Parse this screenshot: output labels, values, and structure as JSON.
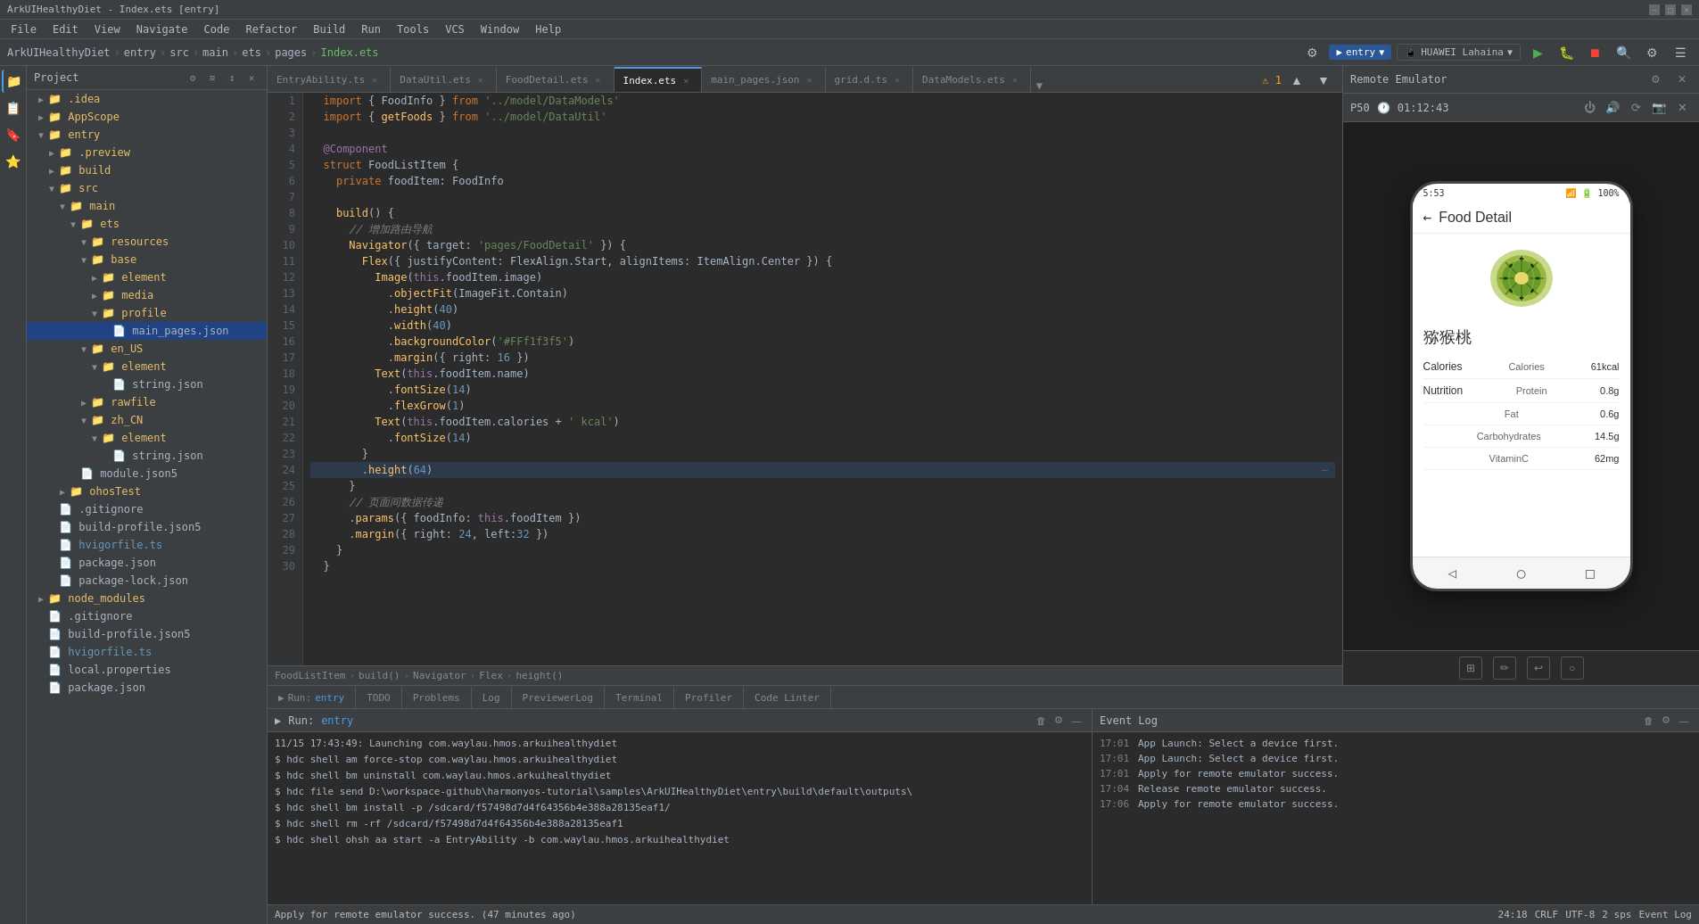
{
  "window": {
    "title": "ArkUIHealthyDiet - Index.ets [entry]",
    "controls": [
      "—",
      "□",
      "✕"
    ]
  },
  "menubar": {
    "items": [
      "File",
      "Edit",
      "View",
      "Navigate",
      "Code",
      "Refactor",
      "Build",
      "Run",
      "Tools",
      "VCS",
      "Window",
      "Help"
    ]
  },
  "project_header": {
    "breadcrumbs": [
      "ArkUIHealthyDiet",
      "entry",
      "src",
      "main",
      "ets",
      "pages",
      "Index.ets"
    ]
  },
  "toolbar": {
    "left_buttons": [
      "⚙",
      "≡",
      "⊞",
      "☷",
      "⚙"
    ],
    "right_buttons": [
      "▶",
      "⏸",
      "⏹",
      "🔨",
      "🔍",
      "⚙",
      "☰"
    ]
  },
  "sidebar": {
    "title": "Project",
    "icons": [
      "⚙",
      "≡",
      "↕",
      "⚙"
    ],
    "tree": [
      {
        "label": ".idea",
        "type": "folder",
        "indent": 1,
        "collapsed": true
      },
      {
        "label": "AppScope",
        "type": "folder",
        "indent": 1,
        "collapsed": true
      },
      {
        "label": "entry",
        "type": "folder",
        "indent": 1,
        "collapsed": false
      },
      {
        "label": ".preview",
        "type": "folder",
        "indent": 2,
        "collapsed": true
      },
      {
        "label": "build",
        "type": "folder",
        "indent": 2,
        "collapsed": true
      },
      {
        "label": "src",
        "type": "folder",
        "indent": 2,
        "collapsed": false
      },
      {
        "label": "main",
        "type": "folder",
        "indent": 3,
        "collapsed": false
      },
      {
        "label": "ets",
        "type": "folder",
        "indent": 4,
        "collapsed": false
      },
      {
        "label": "resources",
        "type": "folder",
        "indent": 4,
        "collapsed": false
      },
      {
        "label": "base",
        "type": "folder",
        "indent": 5,
        "collapsed": false
      },
      {
        "label": "element",
        "type": "folder",
        "indent": 6,
        "collapsed": true
      },
      {
        "label": "media",
        "type": "folder",
        "indent": 6,
        "collapsed": true
      },
      {
        "label": "profile",
        "type": "folder",
        "indent": 6,
        "collapsed": false
      },
      {
        "label": "main_pages.json",
        "type": "json",
        "indent": 7,
        "selected": true
      },
      {
        "label": "en_US",
        "type": "folder",
        "indent": 5,
        "collapsed": false
      },
      {
        "label": "element",
        "type": "folder",
        "indent": 6,
        "collapsed": false
      },
      {
        "label": "string.json",
        "type": "json",
        "indent": 7
      },
      {
        "label": "rawfile",
        "type": "folder",
        "indent": 5,
        "collapsed": true
      },
      {
        "label": "zh_CN",
        "type": "folder",
        "indent": 5,
        "collapsed": false
      },
      {
        "label": "element",
        "type": "folder",
        "indent": 6,
        "collapsed": false
      },
      {
        "label": "string.json",
        "type": "json",
        "indent": 7
      },
      {
        "label": "module.json5",
        "type": "json",
        "indent": 4
      },
      {
        "label": "ohosTest",
        "type": "folder",
        "indent": 3,
        "collapsed": true
      },
      {
        "label": ".gitignore",
        "type": "file",
        "indent": 2
      },
      {
        "label": "build-profile.json5",
        "type": "json",
        "indent": 2
      },
      {
        "label": "hvigorfile.ts",
        "type": "ts",
        "indent": 2
      },
      {
        "label": "package.json",
        "type": "json",
        "indent": 2
      },
      {
        "label": "package-lock.json",
        "type": "json",
        "indent": 2
      },
      {
        "label": "node_modules",
        "type": "folder",
        "indent": 1,
        "collapsed": true
      },
      {
        "label": ".gitignore",
        "type": "file",
        "indent": 1
      },
      {
        "label": "build-profile.json5",
        "type": "json",
        "indent": 1
      },
      {
        "label": "hvigorfile.ts",
        "type": "ts",
        "indent": 1
      },
      {
        "label": "local.properties",
        "type": "file",
        "indent": 1
      },
      {
        "label": "package.json",
        "type": "json",
        "indent": 1
      }
    ]
  },
  "tabs": [
    {
      "label": "EntryAbility.ts",
      "active": false,
      "modified": false
    },
    {
      "label": "DataUtil.ets",
      "active": false,
      "modified": false
    },
    {
      "label": "FoodDetail.ets",
      "active": false,
      "modified": false
    },
    {
      "label": "Index.ets",
      "active": true,
      "modified": false
    },
    {
      "label": "main_pages.json",
      "active": false,
      "modified": false
    },
    {
      "label": "grid.d.ts",
      "active": false,
      "modified": false
    },
    {
      "label": "DataModels.ets",
      "active": false,
      "modified": false
    }
  ],
  "code": {
    "warning": "⚠ 1",
    "lines": [
      {
        "num": 1,
        "content": "  import { FoodInfo } from '../model/DataModels'"
      },
      {
        "num": 2,
        "content": "  import { getFoods } from '../model/DataUtil'"
      },
      {
        "num": 3,
        "content": ""
      },
      {
        "num": 4,
        "content": "  @Component"
      },
      {
        "num": 5,
        "content": "  struct FoodListItem {"
      },
      {
        "num": 6,
        "content": "    private foodItem: FoodInfo"
      },
      {
        "num": 7,
        "content": ""
      },
      {
        "num": 8,
        "content": "    build() {"
      },
      {
        "num": 9,
        "content": "      // 增加路由导航"
      },
      {
        "num": 10,
        "content": "      Navigator({ target: 'pages/FoodDetail' }) {"
      },
      {
        "num": 11,
        "content": "        Flex({ justifyContent: FlexAlign.Start, alignItems: ItemAlign.Center }) {"
      },
      {
        "num": 12,
        "content": "          Image(this.foodItem.image)"
      },
      {
        "num": 13,
        "content": "            .objectFit(ImageFit.Contain)"
      },
      {
        "num": 14,
        "content": "            .height(40)"
      },
      {
        "num": 15,
        "content": "            .width(40)"
      },
      {
        "num": 16,
        "content": "            .backgroundColor('#FFf1f3f5')"
      },
      {
        "num": 17,
        "content": "            .margin({ right: 16 })"
      },
      {
        "num": 18,
        "content": "          Text(this.foodItem.name)"
      },
      {
        "num": 19,
        "content": "            .fontSize(14)"
      },
      {
        "num": 20,
        "content": "            .flexGrow(1)"
      },
      {
        "num": 21,
        "content": "          Text(this.foodItem.calories + ' kcal')"
      },
      {
        "num": 22,
        "content": "            .fontSize(14)"
      },
      {
        "num": 23,
        "content": "        }"
      },
      {
        "num": 24,
        "content": "        .height(64)",
        "highlighted": true
      },
      {
        "num": 25,
        "content": "      }"
      },
      {
        "num": 26,
        "content": "      // 页面间数据传递"
      },
      {
        "num": 27,
        "content": "      .params({ foodInfo: this.foodItem })"
      },
      {
        "num": 28,
        "content": "      .margin({ right: 24, left:32 })"
      },
      {
        "num": 29,
        "content": "    }"
      },
      {
        "num": 30,
        "content": "  }"
      }
    ],
    "breadcrumb": [
      "FoodListItem",
      "build()",
      "Navigator",
      "Flex",
      "height()"
    ]
  },
  "emulator": {
    "header_title": "Remote Emulator",
    "device_selector": "entry",
    "timer": "01:12:43",
    "device_name": "HUAWEI Lahaina",
    "phone": {
      "time": "5:53",
      "battery": "100%",
      "screen_title": "Food Detail",
      "food_name": "猕猴桃",
      "nutrition": [
        {
          "category": "Calories",
          "name": "Calories",
          "value": "61kcal"
        },
        {
          "category": "Nutrition",
          "name": "Protein",
          "value": "0.8g"
        },
        {
          "category": "",
          "name": "Fat",
          "value": "0.6g"
        },
        {
          "category": "",
          "name": "Carbohydrates",
          "value": "14.5g"
        },
        {
          "category": "",
          "name": "VitaminC",
          "value": "62mg"
        }
      ]
    }
  },
  "run_panel": {
    "title": "Run",
    "entry_label": "entry",
    "content": [
      {
        "type": "log",
        "text": "11/15 17:43:49: Launching com.waylau.hmos.arkuihealthydiet"
      },
      {
        "type": "cmd",
        "text": "$ hdc shell am force-stop com.waylau.hmos.arkuihealthydiet"
      },
      {
        "type": "cmd",
        "text": "$ hdc shell bm uninstall com.waylau.hmos.arkuihealthydiet"
      },
      {
        "type": "cmd",
        "text": "$ hdc file send D:\\workspace-github\\harmonyos-tutorial\\samples\\ArkUIHealthyDiet\\entry\\build\\default\\outputs\\"
      },
      {
        "type": "cmd",
        "text": "$ hdc shell bm install -p /sdcard/f57498d7d4f64356b4e388a28135eaf1/"
      },
      {
        "type": "cmd",
        "text": "$ hdc shell rm -rf /sdcard/f57498d7d4f64356b4e388a28135eaf1"
      },
      {
        "type": "cmd",
        "text": "$ hdc shell ohsh aa start -a EntryAbility -b com.waylau.hmos.arkuihealthydiet"
      }
    ],
    "status": "Apply for remote emulator success. (47 minutes ago)"
  },
  "event_log": {
    "title": "Event Log",
    "entries": [
      {
        "time": "17:01",
        "msg": "App Launch: Select a device first."
      },
      {
        "time": "17:01",
        "msg": "App Launch: Select a device first."
      },
      {
        "time": "17:01",
        "msg": "Apply for remote emulator success."
      },
      {
        "time": "17:04",
        "msg": "Release remote emulator success."
      },
      {
        "time": "17:06",
        "msg": "Apply for remote emulator success."
      }
    ]
  },
  "bottom_tabs": [
    {
      "label": "Run",
      "active": false,
      "count": null
    },
    {
      "label": "TODO",
      "active": false,
      "count": null
    },
    {
      "label": "Problems",
      "active": false,
      "count": null
    },
    {
      "label": "Log",
      "active": false,
      "count": null
    },
    {
      "label": "PreviewerLog",
      "active": false,
      "count": null
    },
    {
      "label": "Terminal",
      "active": false,
      "count": null
    },
    {
      "label": "Profiler",
      "active": false,
      "count": null
    },
    {
      "label": "Code Linter",
      "active": false,
      "count": null
    }
  ],
  "status_bar": {
    "left": "Apply for remote emulator success. (47 minutes ago)",
    "run_label": "Run:",
    "entry": "entry",
    "right_items": [
      "24:18",
      "CRLF",
      "UTF-8",
      "2 sps",
      "Event Log"
    ]
  },
  "p50_label": "P50"
}
